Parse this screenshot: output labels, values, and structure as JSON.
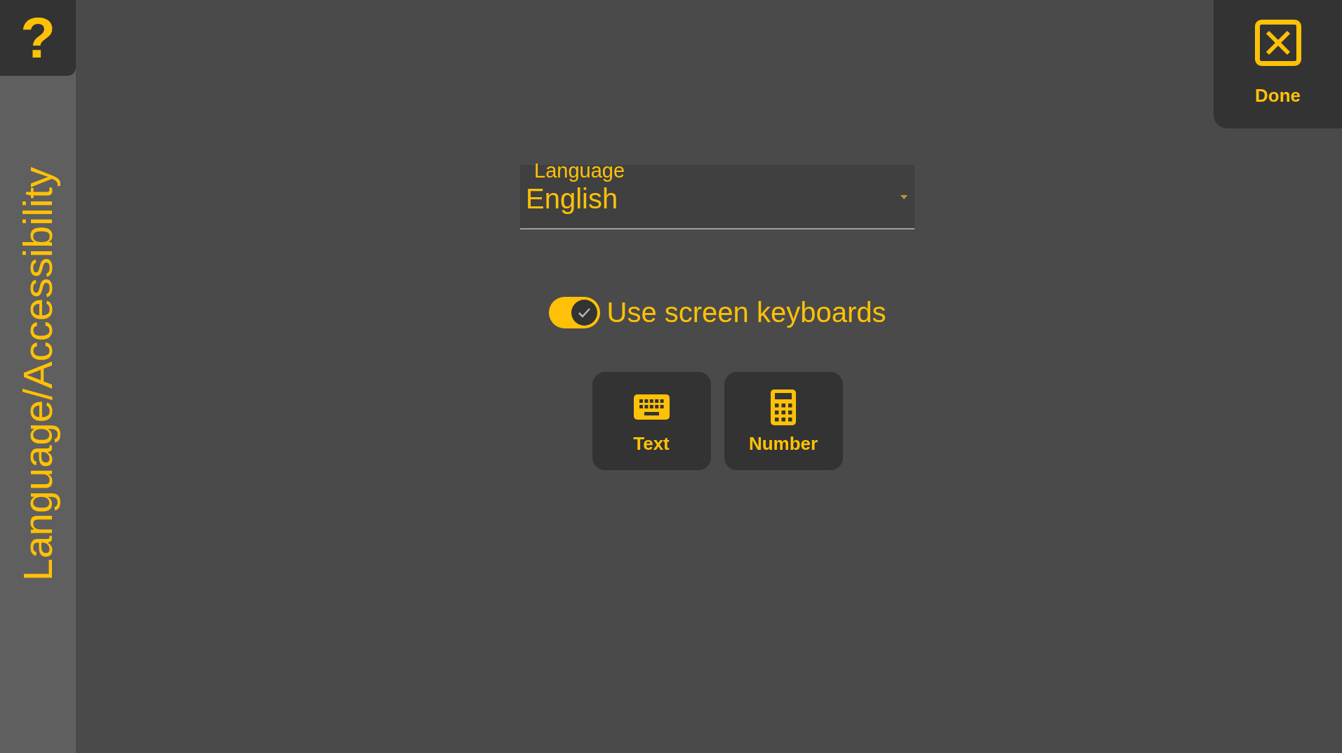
{
  "help_button": {
    "label": "?"
  },
  "sidebar": {
    "title": "Language/Accessibility"
  },
  "language_select": {
    "label": "Language",
    "value": "English"
  },
  "screen_keyboards": {
    "label": "Use screen keyboards",
    "on": true
  },
  "keyboard_buttons": [
    {
      "kind": "text",
      "label": "Text"
    },
    {
      "kind": "number",
      "label": "Number"
    }
  ],
  "done_button": {
    "label": "Done"
  }
}
